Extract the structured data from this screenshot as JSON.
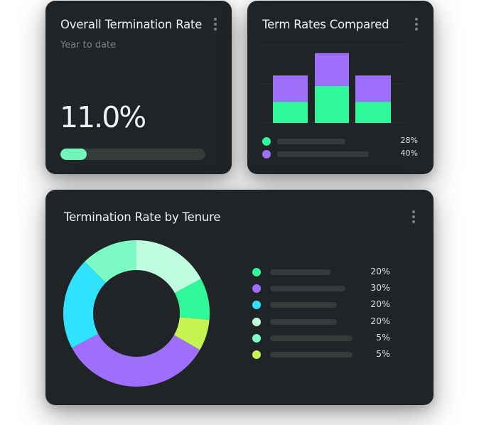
{
  "cards": {
    "overall": {
      "title": "Overall Termination Rate",
      "subtitle": "Year to date",
      "value": "11.0%",
      "progress_fraction": 0.18,
      "progress_color": "#72f5bb",
      "menu_icon": "kebab-menu-icon"
    },
    "compared": {
      "title": "Term Rates Compared",
      "menu_icon": "kebab-menu-icon",
      "legend": [
        {
          "color": "#2ef89a",
          "value": "28%"
        },
        {
          "color": "#9d6ffb",
          "value": "40%"
        }
      ]
    },
    "tenure": {
      "title": "Termination Rate by Tenure",
      "menu_icon": "kebab-menu-icon",
      "legend": [
        {
          "color": "#2ef89a",
          "value": "20%"
        },
        {
          "color": "#9d6ffb",
          "value": "30%"
        },
        {
          "color": "#2fe3ff",
          "value": "20%"
        },
        {
          "color": "#c0fde0",
          "value": "20%"
        },
        {
          "color": "#7cf9c4",
          "value": "5%"
        },
        {
          "color": "#c4f352",
          "value": "5%"
        }
      ]
    }
  },
  "chart_data": [
    {
      "type": "bar",
      "stacked": true,
      "title": "Term Rates Compared",
      "categories": [
        "",
        "",
        ""
      ],
      "series": [
        {
          "name": "series-green",
          "color": "#2ef89a",
          "values": [
            30,
            53,
            30
          ]
        },
        {
          "name": "series-purple",
          "color": "#9d6ffb",
          "values": [
            38,
            47,
            38
          ]
        }
      ],
      "ylim": [
        0,
        112
      ],
      "grid": true,
      "gridlines": [
        0,
        56,
        112
      ],
      "legend_values": [
        "28%",
        "40%"
      ]
    },
    {
      "type": "pie",
      "donut": true,
      "title": "Termination Rate by Tenure",
      "slices": [
        {
          "color": "#c0fde0",
          "fraction": 0.172
        },
        {
          "color": "#2ef89a",
          "fraction": 0.092
        },
        {
          "color": "#c4f352",
          "fraction": 0.069
        },
        {
          "color": "#9d6ffb",
          "fraction": 0.339
        },
        {
          "color": "#2fe3ff",
          "fraction": 0.203
        },
        {
          "color": "#7cf9c4",
          "fraction": 0.125
        }
      ],
      "legend_values": [
        "20%",
        "30%",
        "20%",
        "20%",
        "5%",
        "5%"
      ]
    }
  ]
}
